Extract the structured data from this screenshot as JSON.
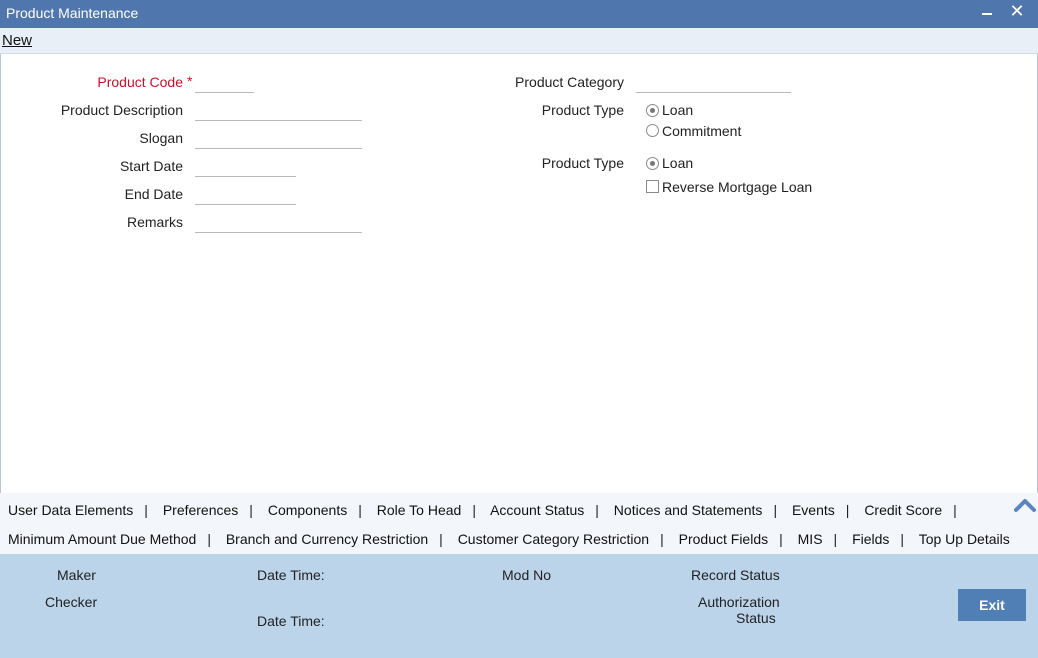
{
  "window": {
    "title": "Product Maintenance",
    "minimize_glyph": "",
    "close_glyph": "✕"
  },
  "toolbar": {
    "new_label": "New"
  },
  "form": {
    "product_code": {
      "label": "Product Code",
      "required_marker": "*",
      "value": ""
    },
    "product_description": {
      "label": "Product Description",
      "value": ""
    },
    "slogan": {
      "label": "Slogan",
      "value": ""
    },
    "start_date": {
      "label": "Start Date",
      "value": ""
    },
    "end_date": {
      "label": "End Date",
      "value": ""
    },
    "remarks": {
      "label": "Remarks",
      "value": ""
    },
    "product_category": {
      "label": "Product Category",
      "value": ""
    },
    "product_type_1": {
      "label": "Product Type",
      "options": [
        "Loan",
        "Commitment"
      ],
      "selected": "Loan"
    },
    "product_type_2": {
      "label": "Product Type",
      "options": [
        "Loan"
      ],
      "selected": "Loan"
    },
    "reverse_mortgage": {
      "label": "Reverse Mortgage Loan",
      "checked": false
    }
  },
  "tabs_row1": [
    "User Data Elements",
    "Preferences",
    "Components",
    "Role To Head",
    "Account Status",
    "Notices and Statements",
    "Events",
    "Credit Score"
  ],
  "tabs_row2": [
    "Minimum Amount Due Method",
    "Branch and Currency Restriction",
    "Customer Category Restriction",
    "Product Fields",
    "MIS",
    "Fields",
    "Top Up Details"
  ],
  "tab_separator": "|",
  "footer": {
    "maker": "Maker",
    "checker": "Checker",
    "date_time_1": "Date Time:",
    "date_time_2": "Date Time:",
    "mod_no": "Mod No",
    "record_status": "Record Status",
    "authorization": "Authorization",
    "status": "Status",
    "exit_label": "Exit"
  },
  "icons": {
    "collapse": "chevron-up-icon"
  },
  "colors": {
    "titlebar": "#4f77ae",
    "footer": "#bcd4ea",
    "required": "#c8102e",
    "exit_button": "#4f7fb4"
  }
}
